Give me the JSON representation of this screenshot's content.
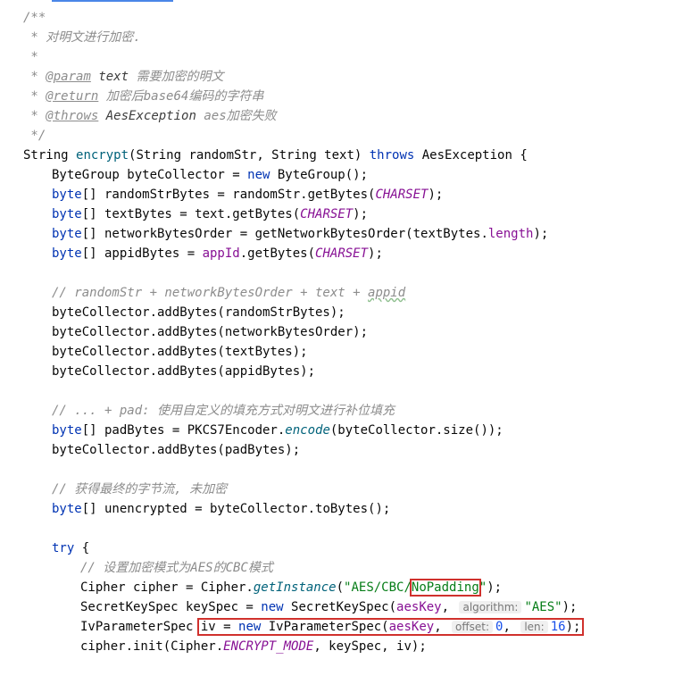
{
  "doc": {
    "open": "/**",
    "desc": " * 对明文进行加密.",
    "blank": " *",
    "star": " * ",
    "param_tag": "@param",
    "param_name": "text",
    "param_desc": "需要加密的明文",
    "return_tag": "@return",
    "return_desc": "加密后base64编码的字符串",
    "throws_tag": "@throws",
    "throws_name": "AesException",
    "throws_desc": "aes加密失败",
    "close": " */"
  },
  "sig": {
    "ret": "String ",
    "name": "encrypt",
    "params": "(String randomStr, String text) ",
    "throws_kw": "throws",
    "rest": " AesException {"
  },
  "l1": {
    "a": "ByteGroup byteCollector = ",
    "kw": "new",
    "b": " ByteGroup();"
  },
  "l2": {
    "kw": "byte",
    "a": "[] randomStrBytes = randomStr.getBytes(",
    "c": "CHARSET",
    "b": ");"
  },
  "l3": {
    "kw": "byte",
    "a": "[] textBytes = text.getBytes(",
    "c": "CHARSET",
    "b": ");"
  },
  "l4": {
    "kw": "byte",
    "a": "[] networkBytesOrder = getNetworkBytesOrder(textBytes.",
    "f": "length",
    "b": ");"
  },
  "l5": {
    "kw": "byte",
    "a": "[] appidBytes = ",
    "f": "appId",
    "m": ".getBytes(",
    "c": "CHARSET",
    "b": ");"
  },
  "c1": {
    "a": "// randomStr + networkBytesOrder + text + ",
    "b": "appid"
  },
  "add1": "byteCollector.addBytes(randomStrBytes);",
  "add2": "byteCollector.addBytes(networkBytesOrder);",
  "add3": "byteCollector.addBytes(textBytes);",
  "add4": "byteCollector.addBytes(appidBytes);",
  "c2": "// ... + pad: 使用自定义的填充方式对明文进行补位填充",
  "pad1": {
    "kw": "byte",
    "a": "[] padBytes = PKCS7Encoder.",
    "s": "encode",
    "b": "(byteCollector.size());"
  },
  "pad2": "byteCollector.addBytes(padBytes);",
  "c3": "// 获得最终的字节流, 未加密",
  "unenc": {
    "kw": "byte",
    "a": "[] unencrypted = byteCollector.toBytes();"
  },
  "try_line": {
    "kw": "try",
    "a": " {"
  },
  "c4": "// 设置加密模式为AES的CBC模式",
  "cipher": {
    "a": "Cipher cipher = Cipher.",
    "s": "getInstance",
    "b": "(",
    "str1": "\"AES/CBC/",
    "str2": "NoPadding",
    "str3": "\"",
    "e": ");"
  },
  "key": {
    "a": "SecretKeySpec keySpec = ",
    "kw": "new",
    "b": " SecretKeySpec(",
    "f": "aesKey",
    "c": ", ",
    "hint": "algorithm:",
    "str": "\"AES\"",
    "e": ");"
  },
  "iv": {
    "a": "IvParameterSpec ",
    "b": "iv = ",
    "kw": "new",
    "c": " IvParameterSpec(",
    "f": "aesKey",
    "d": ", ",
    "hint1": "offset:",
    "n1": "0",
    "sep": ", ",
    "hint2": "len:",
    "n2": "16",
    "e": ");"
  },
  "init": {
    "a": "cipher.init(Cipher.",
    "c": "ENCRYPT_MODE",
    "b": ", keySpec, iv);"
  }
}
